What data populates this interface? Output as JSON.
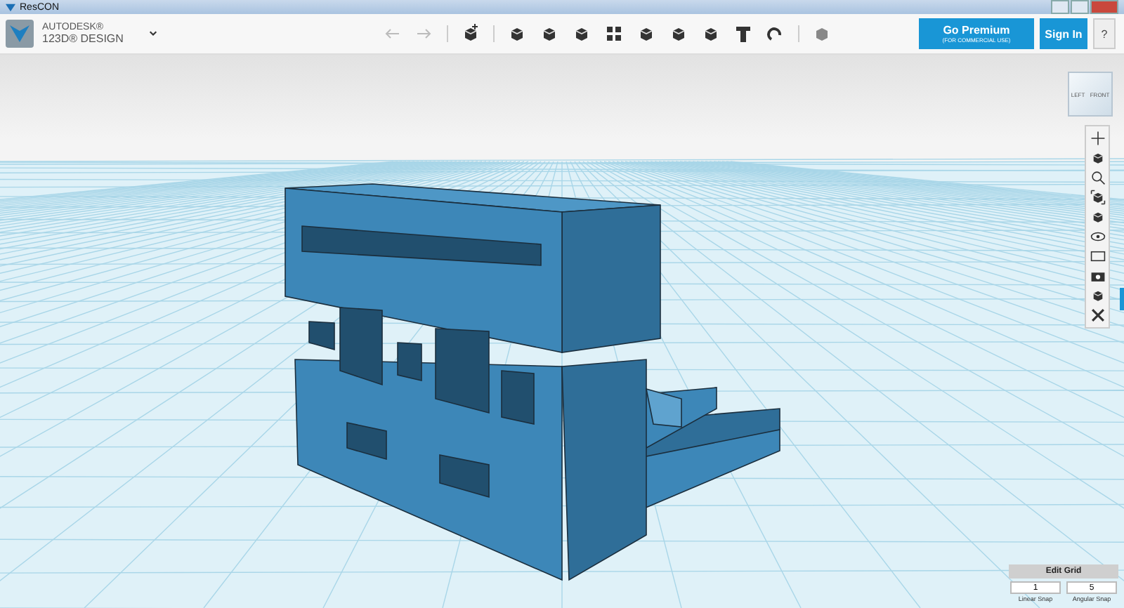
{
  "window": {
    "title": "ResCON"
  },
  "app": {
    "brand": "AUTODESK®",
    "product": "123D® DESIGN"
  },
  "premium": {
    "label": "Go Premium",
    "note": "(FOR COMMERCIAL USE)"
  },
  "sign_in": "Sign In",
  "help": "?",
  "view_cube": {
    "left": "LEFT",
    "front": "FRONT"
  },
  "edit_grid": {
    "title": "Edit Grid",
    "fields": [
      {
        "value": "1",
        "label": "Linear Snap"
      },
      {
        "value": "5",
        "label": "Angular Snap"
      }
    ]
  }
}
